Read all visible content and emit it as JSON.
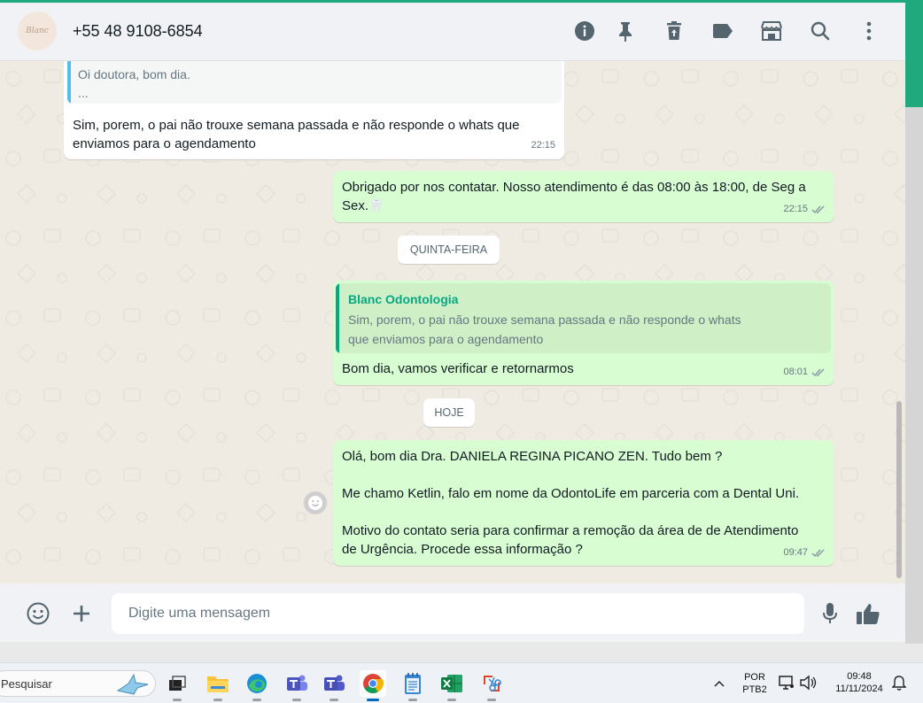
{
  "header": {
    "contact_name": "+55 48 9108-6854",
    "avatar_text": "Blanc"
  },
  "messages": {
    "m1": {
      "quote_text_1": "Oi doutora, bom dia.",
      "quote_text_2": "...",
      "line1": "Sim, porem, o pai não trouxe semana passada e não responde o whats que",
      "line2": "enviamos para o agendamento",
      "time": "22:15"
    },
    "m2": {
      "line1": "Obrigado por nos contatar. Nosso atendimento é das 08:00 às 18:00, de Seg a",
      "line2": "Sex.",
      "emoji": "🦷",
      "time": "22:15"
    },
    "date1": "QUINTA-FEIRA",
    "m3": {
      "quote_author": "Blanc Odontologia",
      "quote_line1": "Sim, porem, o pai não trouxe semana passada e não responde o whats",
      "quote_line2": "que enviamos para o agendamento",
      "text": "Bom dia, vamos verificar e retornarmos",
      "time": "08:01"
    },
    "date2": "HOJE",
    "m4": {
      "p1": "Olá, bom dia Dra.  DANIELA REGINA PICANO ZEN. Tudo bem ?",
      "p2": "Me chamo Ketlin, falo em nome da OdontoLife em parceria com a Dental Uni.",
      "p3a": "Motivo do contato seria para confirmar a remoção da área de de Atendimento",
      "p3b": "de Urgência. Procede essa informação ?",
      "time": "09:47"
    }
  },
  "composer": {
    "placeholder": "Digite uma mensagem"
  },
  "taskbar": {
    "search_label": "Pesquisar",
    "lang_top": "POR",
    "lang_bottom": "PTB2",
    "time": "09:48",
    "date": "11/11/2024"
  },
  "colors": {
    "accent": "#1fa97d",
    "outgoing_bubble": "#d9fdd3",
    "incoming_bubble": "#ffffff",
    "quote_author": "#06a884"
  }
}
